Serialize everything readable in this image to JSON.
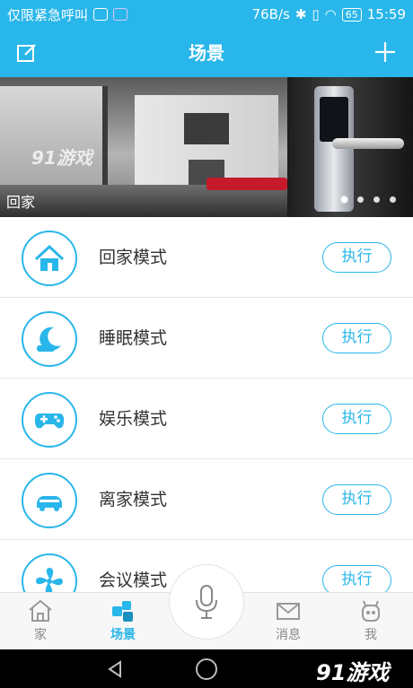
{
  "status_bar": {
    "carrier": "仅限紧急呼叫",
    "speed": "76B/s",
    "battery": "65",
    "time": "15:59"
  },
  "header": {
    "title": "场景",
    "edit_icon": "edit-icon",
    "add_icon": "plus-icon"
  },
  "banner": {
    "caption": "回家",
    "watermark": "91游戏",
    "slide_count": 4
  },
  "scenes": [
    {
      "label": "回家模式",
      "icon": "home-icon",
      "action": "执行"
    },
    {
      "label": "睡眠模式",
      "icon": "moon-icon",
      "action": "执行"
    },
    {
      "label": "娱乐模式",
      "icon": "gamepad-icon",
      "action": "执行"
    },
    {
      "label": "离家模式",
      "icon": "car-icon",
      "action": "执行"
    },
    {
      "label": "会议模式",
      "icon": "fan-icon",
      "action": "执行"
    }
  ],
  "bottom_nav": {
    "items": [
      {
        "label": "家",
        "icon": "house-icon"
      },
      {
        "label": "场景",
        "icon": "scene-icon",
        "active": true
      },
      {
        "label": "消息",
        "icon": "mail-icon"
      },
      {
        "label": "我",
        "icon": "robot-icon"
      }
    ],
    "mic_icon": "microphone-icon"
  },
  "system_nav": {
    "brand": "91游戏"
  },
  "colors": {
    "accent": "#29b6ea"
  }
}
